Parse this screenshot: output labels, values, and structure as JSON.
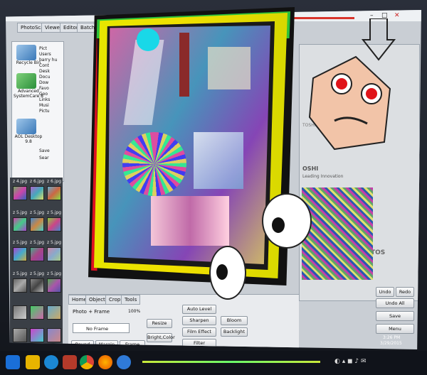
{
  "app": {
    "tabs": [
      "PhotoScape",
      "Viewer",
      "Editor",
      "Batch"
    ]
  },
  "desktop_icons": [
    {
      "label": "Recycle Bin"
    },
    {
      "label": "Advanced SystemCare 8"
    },
    {
      "label": "AOL Desktop 9.8"
    }
  ],
  "tree": {
    "items": [
      "Pict",
      "Users",
      "barry hu",
      "Cont",
      "Desk",
      "Docu",
      "Dow",
      "Favo",
      "Goo",
      "Links",
      "Musi",
      "Pictu",
      "Save",
      "Sear"
    ]
  },
  "thumbnails": {
    "labels": [
      "z 4.jpg",
      "z 6.jpg",
      "z 6.jpg",
      "z 5.jpg",
      "z 5.jpg",
      "z 5.jpg",
      "z 5.jpg",
      "z 5.jpg",
      "z 5.jpg",
      "z 5.jpg",
      "z 5.jpg",
      "z 5.jpg"
    ]
  },
  "editor": {
    "bottom_tabs": [
      "Home",
      "Object",
      "Crop",
      "Tools"
    ],
    "photo_frame_label": "Photo + Frame",
    "zoom": "100%",
    "frame_select": "No Frame",
    "buttons": {
      "auto_level": "Auto Level",
      "sharpen": "Sharpen",
      "bloom": "Bloom",
      "film_effect": "Film Effect",
      "backlight": "Backlight",
      "resize": "Resize",
      "bright_color": "Bright,Color",
      "filter": "Filter",
      "round": "Round",
      "margin": "Margin",
      "frame_line": "Frame Line"
    }
  },
  "right_panel": {
    "undo": "Undo",
    "redo": "Redo",
    "undo_all": "Undo All",
    "save": "Save",
    "menu": "Menu",
    "brand_fragments": [
      "TOSHIBA",
      "OSHI",
      "Leading Innovation",
      "TOS"
    ]
  },
  "taskbar": {
    "time": "3:26 PM",
    "date": "3/29/2015"
  },
  "colors": {
    "frame_yellow": "#e6e600",
    "frame_black": "#111111",
    "taskbar": "#10131a",
    "accent_red": "#d9342b"
  }
}
